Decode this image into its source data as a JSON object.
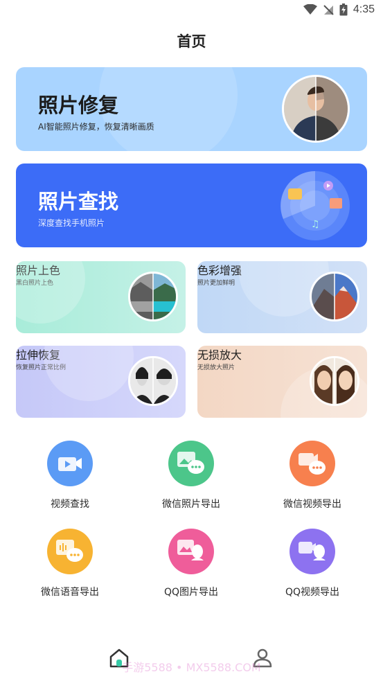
{
  "status_bar": {
    "time": "4:35",
    "icons": [
      "wifi-icon",
      "no-signal-icon",
      "battery-icon"
    ]
  },
  "header": {
    "title": "首页"
  },
  "banners": {
    "restore": {
      "title": "照片修复",
      "subtitle": "AI智能照片修复，恢复清晰画质"
    },
    "find": {
      "title": "照片查找",
      "subtitle": "深度查找手机照片"
    }
  },
  "features": {
    "colorize": {
      "title": "照片上色",
      "subtitle": "黑白照片上色"
    },
    "enhance": {
      "title": "色彩增强",
      "subtitle": "照片更加鲜明"
    },
    "stretch": {
      "title": "拉伸恢复",
      "subtitle": "恢复照片正常比例"
    },
    "enlarge": {
      "title": "无损放大",
      "subtitle": "无损放大照片"
    }
  },
  "tools": [
    {
      "label": "视频查找",
      "icon": "video-camera-icon",
      "color": "#5b9bf5"
    },
    {
      "label": "微信照片导出",
      "icon": "wechat-photo-icon",
      "color": "#4cc68a"
    },
    {
      "label": "微信视频导出",
      "icon": "wechat-video-icon",
      "color": "#f7804e"
    },
    {
      "label": "微信语音导出",
      "icon": "wechat-voice-icon",
      "color": "#f7b332"
    },
    {
      "label": "QQ图片导出",
      "icon": "qq-photo-icon",
      "color": "#ef5d9a"
    },
    {
      "label": "QQ视频导出",
      "icon": "qq-video-icon",
      "color": "#8d72f0"
    }
  ],
  "bottom_nav": {
    "items": [
      "home-icon",
      "profile-icon"
    ]
  },
  "watermark": "手游5588 • MX5588.COM"
}
